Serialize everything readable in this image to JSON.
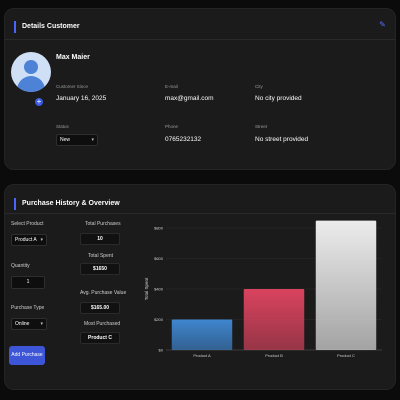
{
  "customer": {
    "title": "Details Customer",
    "edit_icon": "edit-icon",
    "name": "Max Maier",
    "fields": {
      "customer_since_label": "Customer Since",
      "customer_since": "January 16, 2025",
      "email_label": "E-mail",
      "email": "max@gmail.com",
      "city_label": "City",
      "city": "No city provided",
      "status_label": "Status",
      "status": "New",
      "phone_label": "Phone",
      "phone": "0765232132",
      "street_label": "Street",
      "street": "No street provided"
    }
  },
  "purchase": {
    "title": "Purchase History & Overview",
    "select_product_label": "Select Product",
    "select_product": "Product A",
    "quantity_label": "Quantity",
    "quantity": "1",
    "purchase_type_label": "Purchase Type",
    "purchase_type": "Online",
    "add_button": "Add Purchase",
    "stats": {
      "total_purchases_label": "Total Purchases",
      "total_purchases": "10",
      "total_spent_label": "Total Spent",
      "total_spent": "$1650",
      "avg_value_label": "Avg. Purchase Value",
      "avg_value": "$165.00",
      "most_purchased_label": "Most Purchased",
      "most_purchased": "Product C"
    }
  },
  "chart_data": {
    "type": "bar",
    "categories": [
      "Product A",
      "Product B",
      "Product C"
    ],
    "values": [
      200,
      400,
      900
    ],
    "ylabel": "Total Spent",
    "xlabel": "",
    "ylim": [
      0,
      800
    ],
    "yticks": [
      "$0",
      "$200",
      "$400",
      "$600",
      "$800"
    ],
    "colors": [
      "#3f86cf",
      "#d9435e",
      "#ececec"
    ],
    "grid": true
  }
}
